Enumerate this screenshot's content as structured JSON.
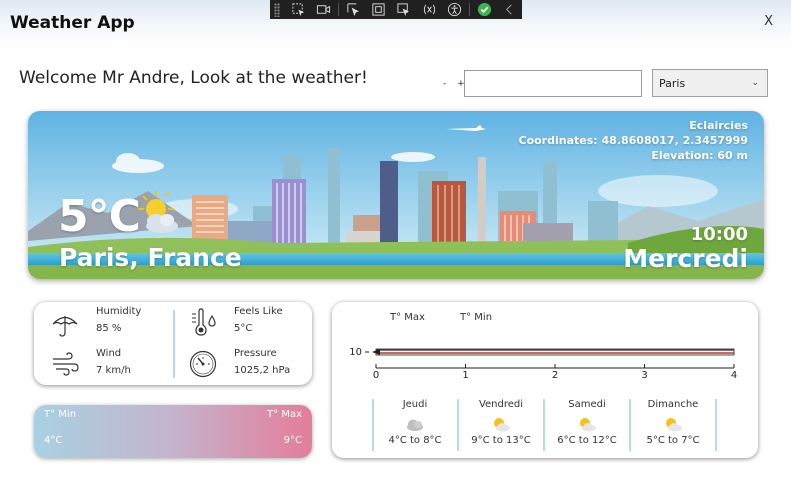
{
  "window": {
    "title": "Weather App",
    "close_label": "X"
  },
  "welcome": "Welcome Mr Andre, Look at the weather!",
  "stepper_label": "- +",
  "search": {
    "value": "",
    "placeholder": ""
  },
  "city_select": {
    "selected": "Paris"
  },
  "current": {
    "temperature": "5°C",
    "location": "Paris, France",
    "condition": "Eclaircies",
    "coordinates": "Coordinates: 48.8608017, 2.3457999",
    "elevation": "Elevation: 60 m",
    "time": "10:00",
    "day": "Mercredi",
    "icon": "partly-cloudy-icon"
  },
  "details": {
    "humidity_label": "Humidity",
    "humidity_value": "85 %",
    "wind_label": "Wind",
    "wind_value": "7 km/h",
    "feels_label": "Feels Like",
    "feels_value": "5°C",
    "pressure_label": "Pressure",
    "pressure_value": "1025,2 hPa"
  },
  "minmax": {
    "min_label": "T° Min",
    "max_label": "T° Max",
    "min_value": "4°C",
    "max_value": "9°C",
    "colors": {
      "min": "#a8d1e3",
      "max": "#e47d9a"
    }
  },
  "forecast": {
    "legend_max": "T° Max",
    "legend_min": "T° Min",
    "days": [
      {
        "name": "Jeudi",
        "range": "4°C to 8°C",
        "icon": "cloud-icon"
      },
      {
        "name": "Vendredi",
        "range": "9°C to 13°C",
        "icon": "partly-sunny-icon"
      },
      {
        "name": "Samedi",
        "range": "6°C to 12°C",
        "icon": "partly-sunny-icon"
      },
      {
        "name": "Dimanche",
        "range": "5°C to 7°C",
        "icon": "partly-sunny-icon"
      }
    ]
  },
  "chart_data": {
    "type": "line",
    "x": [
      0,
      1,
      2,
      3,
      4
    ],
    "series": [
      {
        "name": "T° Max",
        "values": [
          10,
          10,
          10,
          10,
          10
        ],
        "color": "#333333"
      },
      {
        "name": "T° Min",
        "values": [
          10,
          10,
          10,
          10,
          10
        ],
        "color": "#c0392b"
      }
    ],
    "xticks": [
      "0",
      "1",
      "2",
      "3",
      "4"
    ],
    "yticks": [
      "10"
    ],
    "xlim": [
      0,
      4
    ],
    "grid": false
  }
}
